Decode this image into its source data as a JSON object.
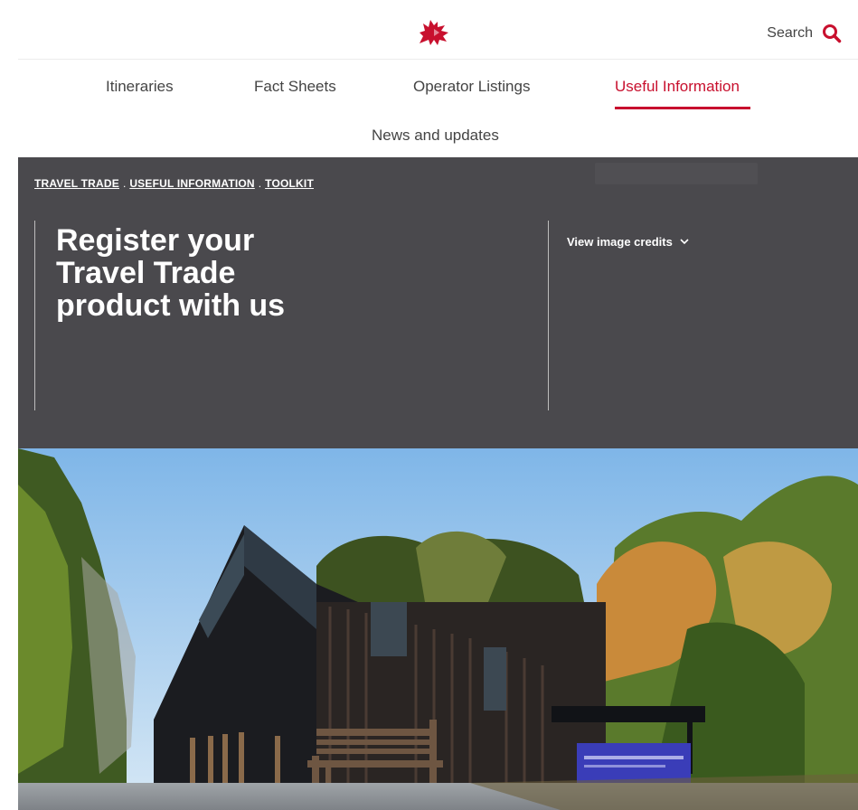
{
  "header": {
    "logo_icon": "welsh-dragon-icon",
    "search_label": "Search",
    "search_icon": "search-icon",
    "accent": "#c8102e"
  },
  "nav": {
    "items": [
      {
        "label": "Itineraries"
      },
      {
        "label": "Fact Sheets"
      },
      {
        "label": "Operator Listings"
      },
      {
        "label": "Useful Information"
      },
      {
        "label": "News and updates"
      }
    ],
    "active_index": 3
  },
  "hero": {
    "breadcrumb": [
      "TRAVEL TRADE",
      "USEFUL INFORMATION",
      "TOOLKIT"
    ],
    "separator": ".",
    "title": "Register your Travel Trade product with us",
    "credits_label": "View image credits",
    "background": "#4a494d"
  }
}
